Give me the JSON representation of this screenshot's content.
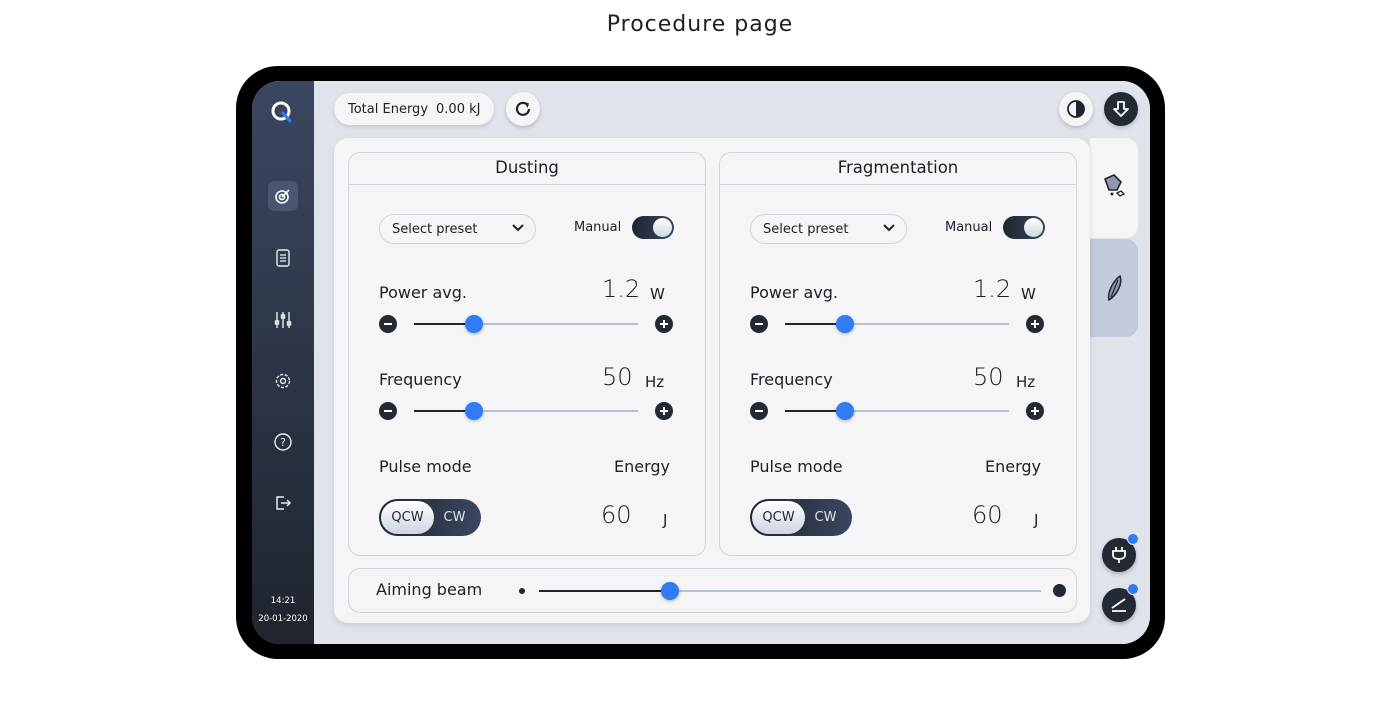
{
  "page_title": "Procedure page",
  "sidebar": {
    "items": [
      {
        "name": "treatment",
        "icon": "target-icon",
        "active": true
      },
      {
        "name": "reports",
        "icon": "document-icon",
        "active": false
      },
      {
        "name": "adjustments",
        "icon": "sliders-icon",
        "active": false
      },
      {
        "name": "settings",
        "icon": "gear-icon",
        "active": false
      },
      {
        "name": "help",
        "icon": "help-icon",
        "active": false
      },
      {
        "name": "logout",
        "icon": "logout-icon",
        "active": false
      }
    ],
    "time": "14:21",
    "date": "20-01-2020"
  },
  "header": {
    "total_energy_label": "Total Energy",
    "total_energy_value": "0.00 kJ"
  },
  "cards": [
    {
      "title": "Dusting",
      "preset_placeholder": "Select preset",
      "manual_label": "Manual",
      "manual_on": true,
      "power": {
        "label": "Power avg.",
        "value": "1.2",
        "unit": "W",
        "slider_fraction": 0.27
      },
      "frequency": {
        "label": "Frequency",
        "value": "50",
        "unit": "Hz",
        "slider_fraction": 0.27
      },
      "pulse_mode": {
        "label": "Pulse mode",
        "options": [
          "QCW",
          "CW"
        ],
        "selected": "QCW"
      },
      "energy": {
        "label": "Energy",
        "value": "60",
        "unit": "J"
      }
    },
    {
      "title": "Fragmentation",
      "preset_placeholder": "Select preset",
      "manual_label": "Manual",
      "manual_on": true,
      "power": {
        "label": "Power avg.",
        "value": "1.2",
        "unit": "W",
        "slider_fraction": 0.27
      },
      "frequency": {
        "label": "Frequency",
        "value": "50",
        "unit": "Hz",
        "slider_fraction": 0.27
      },
      "pulse_mode": {
        "label": "Pulse mode",
        "options": [
          "QCW",
          "CW"
        ],
        "selected": "QCW"
      },
      "energy": {
        "label": "Energy",
        "value": "60",
        "unit": "J"
      }
    }
  ],
  "aiming_beam": {
    "label": "Aiming beam",
    "slider_fraction": 0.26
  },
  "side_tabs": [
    {
      "name": "stone",
      "icon": "stone-icon",
      "active": true
    },
    {
      "name": "tissue",
      "icon": "tissue-icon",
      "active": false
    }
  ],
  "colors": {
    "accent": "#2f7cf6",
    "dark": "#232a36",
    "sidebar": "#2b3445"
  }
}
